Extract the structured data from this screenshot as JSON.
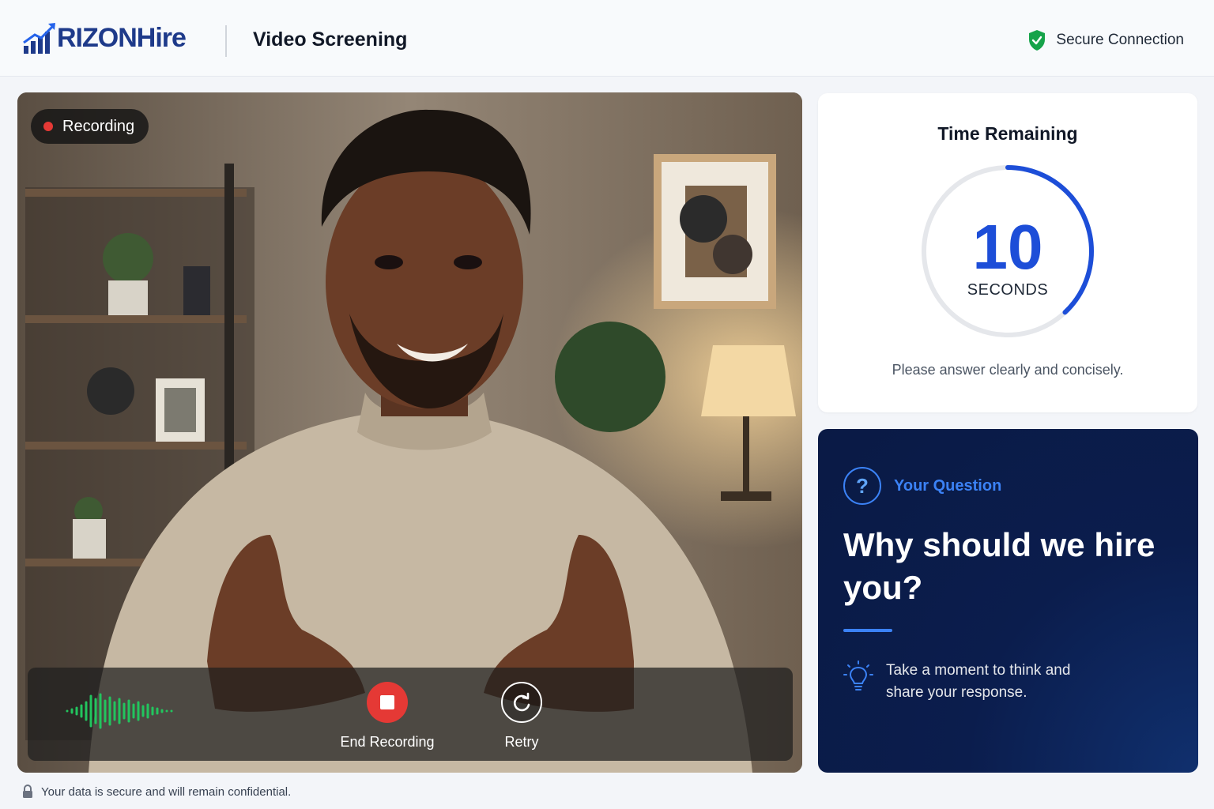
{
  "header": {
    "brand": "RIZONHire",
    "title": "Video Screening",
    "secure_label": "Secure Connection"
  },
  "video": {
    "recording_label": "Recording",
    "controls": {
      "end_label": "End Recording",
      "retry_label": "Retry"
    }
  },
  "timer": {
    "title": "Time Remaining",
    "value": "10",
    "unit": "SECONDS",
    "hint": "Please answer clearly and concisely.",
    "progress": 0.38
  },
  "question": {
    "label": "Your Question",
    "text": "Why should we hire you?",
    "tip": "Take a moment to think and share your response."
  },
  "footer": {
    "notice": "Your data is secure and will remain confidential."
  },
  "colors": {
    "brand": "#1e3a8a",
    "accent": "#1d4ed8",
    "record": "#e53935",
    "secure": "#16a34a",
    "question_bg": "#0b1d4d"
  },
  "icons": [
    "logo-bars-icon",
    "shield-check-icon",
    "record-dot-icon",
    "audio-wave-icon",
    "stop-icon",
    "retry-icon",
    "question-icon",
    "lightbulb-icon",
    "lock-icon"
  ]
}
